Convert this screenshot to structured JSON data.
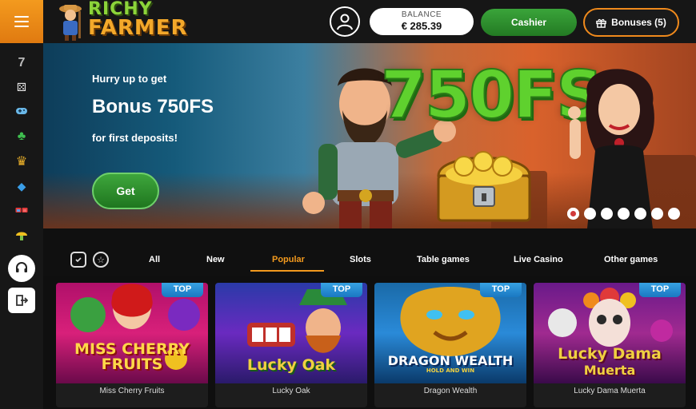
{
  "header": {
    "logo_line1": "RICHY",
    "logo_line2": "FARMER",
    "balance_label": "BALANCE",
    "balance_value": "€ 285.39",
    "cashier_label": "Cashier",
    "bonuses_label": "Bonuses (5)"
  },
  "sidebar": {
    "items": [
      {
        "icon": "seven-icon",
        "glyph": "7"
      },
      {
        "icon": "dice-icon",
        "glyph": "⚄"
      },
      {
        "icon": "gamepad-icon",
        "glyph": "🎮"
      },
      {
        "icon": "clover-icon",
        "glyph": "♣"
      },
      {
        "icon": "crown-icon",
        "glyph": "♛"
      },
      {
        "icon": "gem-icon",
        "glyph": "◆"
      },
      {
        "icon": "glasses-icon",
        "glyph": "▭"
      },
      {
        "icon": "mushroom-icon",
        "glyph": "●"
      }
    ]
  },
  "banner": {
    "hurry": "Hurry up to get",
    "title": "Bonus 750FS",
    "subtitle": "for first deposits!",
    "button": "Get",
    "big_text": "750FS",
    "slides": 7,
    "active_slide": 1
  },
  "tabs": {
    "items": [
      "All",
      "New",
      "Popular",
      "Slots",
      "Table games",
      "Live Casino",
      "Other games"
    ],
    "active": "Popular"
  },
  "games": [
    {
      "name": "Miss Cherry Fruits",
      "badge": "TOP",
      "art_title": "MISS CHERRY FRUITS"
    },
    {
      "name": "Lucky Oak",
      "badge": "TOP",
      "art_title": "Lucky Oak"
    },
    {
      "name": "Dragon Wealth",
      "badge": "TOP",
      "art_title": "DRAGON WEALTH",
      "art_sub": "HOLD AND WIN"
    },
    {
      "name": "Lucky Dama Muerta",
      "badge": "TOP",
      "art_title": "Lucky Dama",
      "art_title2": "Muerta"
    }
  ],
  "colors": {
    "accent": "#f39a1e",
    "green": "#2f8f2f",
    "badge": "#2a90d8"
  }
}
